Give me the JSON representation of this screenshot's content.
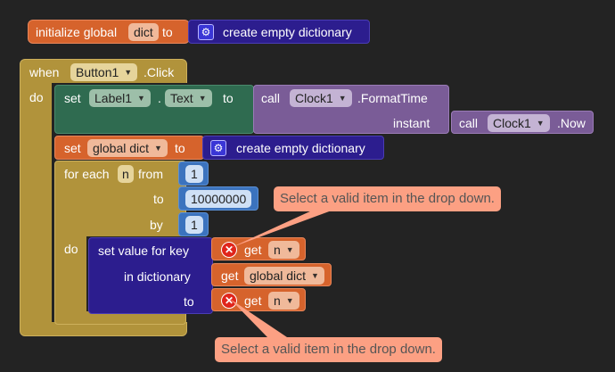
{
  "global_block": {
    "keyword": "initialize global",
    "var_name": "dict",
    "to": "to",
    "value": "create empty dictionary"
  },
  "event_block": {
    "when": "when",
    "component": "Button1",
    "event": ".Click",
    "do": "do"
  },
  "set_label": {
    "set": "set",
    "component": "Label1",
    "dot": ".",
    "property": "Text",
    "to": "to",
    "call": "call",
    "clock": "Clock1",
    "method": ".FormatTime",
    "instant": "instant",
    "call2": "call",
    "clock2": "Clock1",
    "method2": ".Now"
  },
  "set_global": {
    "set": "set",
    "var": "global dict",
    "to": "to",
    "value": "create empty dictionary"
  },
  "for_each": {
    "label": "for each",
    "var": "n",
    "from": "from",
    "from_val": "1",
    "to": "to",
    "to_val": "10000000",
    "by": "by",
    "by_val": "1",
    "do": "do"
  },
  "set_value": {
    "label": "set value for key",
    "in_dict": "in dictionary",
    "to": "to",
    "get1": "get",
    "get1_var": "n",
    "get2": "get",
    "get2_var": "global dict",
    "get3": "get",
    "get3_var": "n"
  },
  "warnings": {
    "top": "Select a valid item in the drop down.",
    "bottom": "Select a valid item in the drop down."
  },
  "colors": {
    "background": "#232323",
    "variables": "#d6632c",
    "dictionary": "#2c1d8e",
    "control": "#b1933b",
    "component_set": "#2f6b50",
    "component_call": "#7a5c97",
    "math": "#3b73be",
    "warning": "#fca083"
  }
}
